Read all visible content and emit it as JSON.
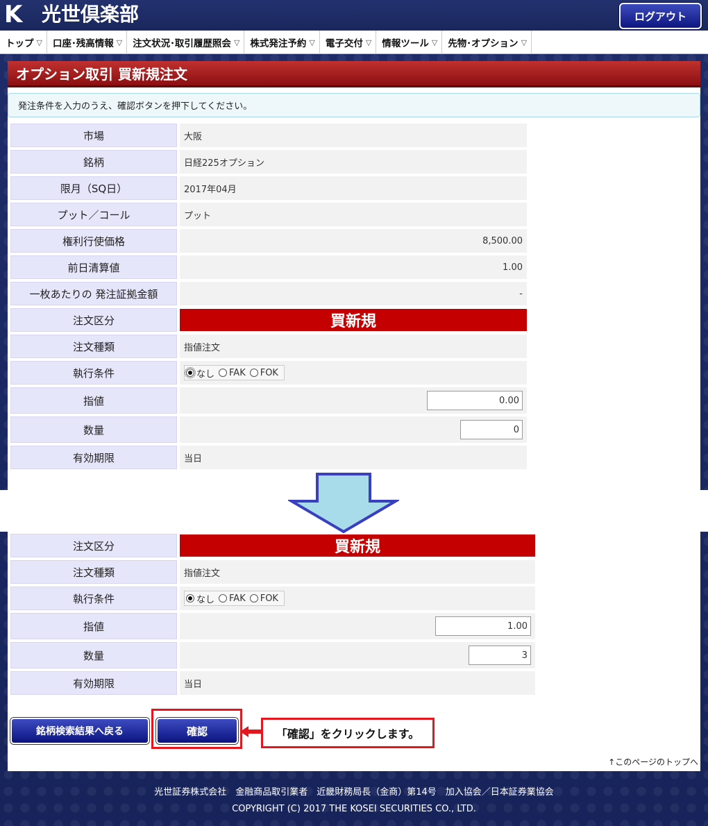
{
  "header": {
    "logo_mark": "K",
    "logo_text": "光世倶楽部",
    "logout_label": "ログアウト"
  },
  "nav": [
    {
      "label": "トップ"
    },
    {
      "label": "口座･残高情報"
    },
    {
      "label": "注文状況･取引履歴照会"
    },
    {
      "label": "株式発注予約"
    },
    {
      "label": "電子交付"
    },
    {
      "label": "情報ツール"
    },
    {
      "label": "先物･オプション"
    }
  ],
  "page": {
    "title": "オプション取引 買新規注文",
    "info": "発注条件を入力のうえ、確認ボタンを押下してください。"
  },
  "form_top": {
    "market": {
      "label": "市場",
      "value": "大阪"
    },
    "issue": {
      "label": "銘柄",
      "value": "日経225オプション"
    },
    "month": {
      "label": "限月（SQ日）",
      "value": "2017年04月"
    },
    "putcall": {
      "label": "プット／コール",
      "value": "プット"
    },
    "strike": {
      "label": "権利行使価格",
      "value": "8,500.00"
    },
    "settle": {
      "label": "前日清算値",
      "value": "1.00"
    },
    "margin": {
      "label": "一枚あたりの 発注証拠金額",
      "value": "-"
    },
    "order_type": {
      "label": "注文区分",
      "value": "買新規"
    },
    "order_kind": {
      "label": "注文種類",
      "value": "指値注文"
    },
    "exec": {
      "label": "執行条件",
      "opt1": "なし",
      "opt2": "FAK",
      "opt3": "FOK"
    },
    "limit": {
      "label": "指値",
      "value": "0.00"
    },
    "qty": {
      "label": "数量",
      "value": "0"
    },
    "expiry": {
      "label": "有効期限",
      "value": "当日"
    }
  },
  "form_bottom": {
    "order_type": {
      "label": "注文区分",
      "value": "買新規"
    },
    "order_kind": {
      "label": "注文種類",
      "value": "指値注文"
    },
    "exec": {
      "label": "執行条件",
      "opt1": "なし",
      "opt2": "FAK",
      "opt3": "FOK"
    },
    "limit": {
      "label": "指値",
      "value": "1.00"
    },
    "qty": {
      "label": "数量",
      "value": "3"
    },
    "expiry": {
      "label": "有効期限",
      "value": "当日"
    }
  },
  "buttons": {
    "back": "銘柄検索結果へ戻る",
    "confirm": "確認"
  },
  "callout": "「確認」をクリックします。",
  "to_top": "↑このページのトップへ",
  "footer": {
    "line1": "光世証券株式会社　金融商品取引業者　近畿財務局長（金商）第14号　加入協会／日本証券業協会",
    "line2": "COPYRIGHT (C) 2017 THE KOSEI SECURITIES CO., LTD."
  },
  "colors": {
    "navy": "#1c2a66",
    "title_red": "#a81a1c",
    "order_red": "#c50000",
    "callout_red": "#e5161d",
    "arrow_fill": "#a9dcea",
    "arrow_stroke": "#3a3fbf"
  }
}
